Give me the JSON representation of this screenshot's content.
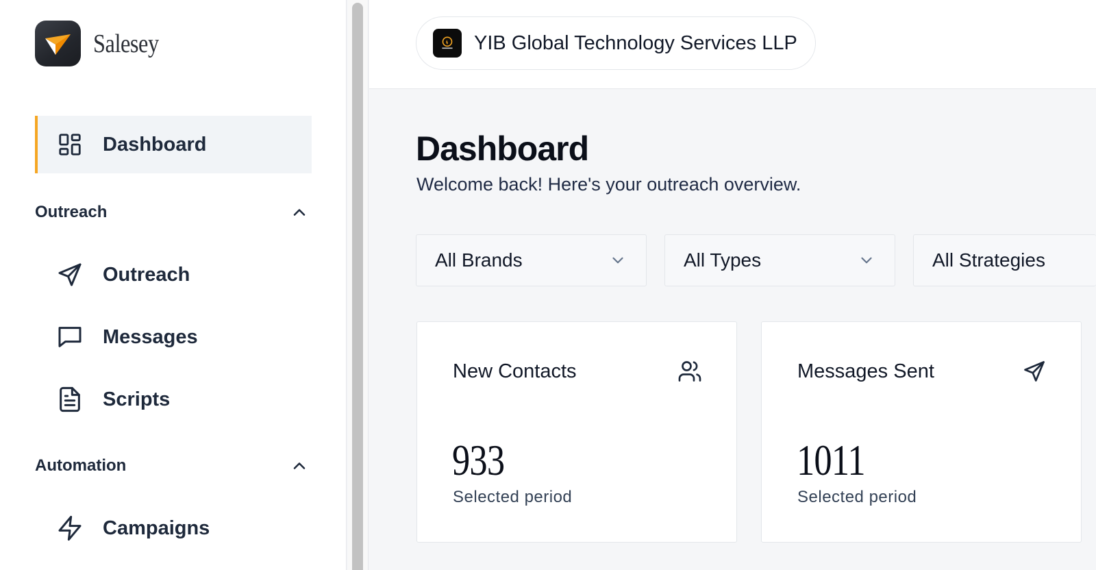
{
  "app": {
    "brand_name": "Salesey"
  },
  "sidebar": {
    "dashboard": {
      "label": "Dashboard",
      "icon": "grid-icon",
      "active": true
    },
    "sections": [
      {
        "title": "Outreach",
        "expanded": true,
        "items": [
          {
            "label": "Outreach",
            "icon": "send-icon"
          },
          {
            "label": "Messages",
            "icon": "message-square-icon"
          },
          {
            "label": "Scripts",
            "icon": "file-text-icon"
          }
        ]
      },
      {
        "title": "Automation",
        "expanded": true,
        "items": [
          {
            "label": "Campaigns",
            "icon": "zap-icon"
          }
        ]
      }
    ]
  },
  "topbar": {
    "organization": "YIB Global Technology Services LLP"
  },
  "main": {
    "title": "Dashboard",
    "subtitle": "Welcome back! Here's your outreach overview.",
    "filters": [
      {
        "value": "All Brands"
      },
      {
        "value": "All Types"
      },
      {
        "value": "All Strategies"
      }
    ],
    "stats": [
      {
        "label": "New Contacts",
        "value": "933",
        "caption": "Selected period",
        "icon": "users-icon"
      },
      {
        "label": "Messages Sent",
        "value": "1011",
        "caption": "Selected period",
        "icon": "send-icon"
      }
    ]
  },
  "colors": {
    "accent": "#f5a623",
    "active_bg": "#f1f4f7",
    "text": "#1e293b"
  }
}
